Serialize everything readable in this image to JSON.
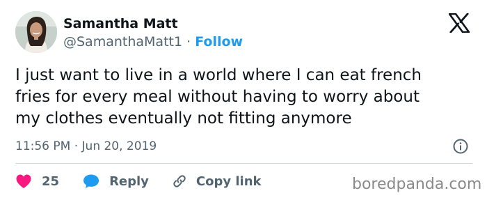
{
  "author": {
    "name": "Samantha Matt",
    "handle": "@SamanthaMatt1",
    "separator": "·",
    "follow_label": "Follow"
  },
  "tweet": {
    "text": "I just want to live in a world where I can eat french\nfries for every meal without having to worry about\nmy clothes eventually not fitting anymore",
    "timestamp": "11:56 PM · Jun 20, 2019"
  },
  "actions": {
    "like_count": "25",
    "reply_label": "Reply",
    "copy_link_label": "Copy link"
  },
  "watermark": "boredpanda.com",
  "icons": {
    "platform": "x-logo-icon",
    "info": "info-icon",
    "like": "heart-icon",
    "reply": "speech-bubble-icon",
    "copy": "link-icon"
  },
  "colors": {
    "accent": "#1d9bf0",
    "like": "#f91880",
    "text": "#0f1419",
    "secondary": "#536471",
    "divider": "#cfd9de"
  }
}
